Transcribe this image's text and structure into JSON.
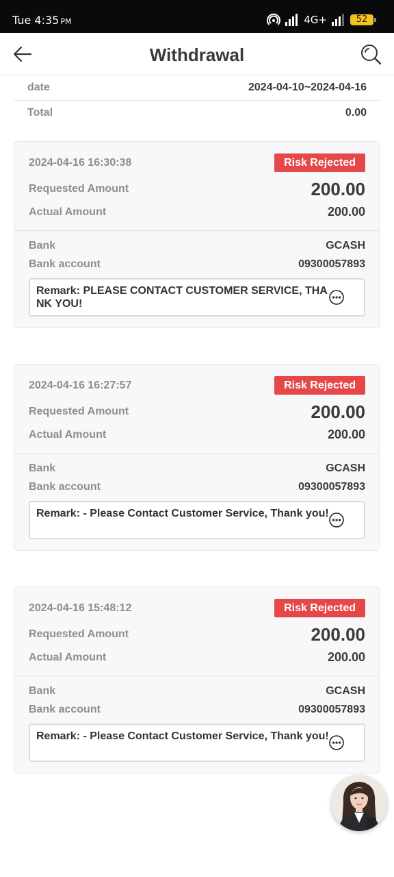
{
  "status_bar": {
    "time": "Tue 4:35",
    "ampm": "PM",
    "network": "4G+",
    "battery": "52"
  },
  "header": {
    "title": "Withdrawal"
  },
  "summary": {
    "date_label": "date",
    "date_value": "2024-04-10~2024-04-16",
    "total_label": "Total",
    "total_value": "0.00"
  },
  "records": [
    {
      "datetime": "2024-04-16 16:30:38",
      "status": "Risk Rejected",
      "requested_label": "Requested Amount",
      "requested_amount": "200.00",
      "actual_label": "Actual Amount",
      "actual_amount": "200.00",
      "bank_label": "Bank",
      "bank": "GCASH",
      "account_label": "Bank account",
      "account": "09300057893",
      "remark": "Remark: PLEASE CONTACT CUSTOMER SERVICE, THANK YOU!"
    },
    {
      "datetime": "2024-04-16 16:27:57",
      "status": "Risk Rejected",
      "requested_label": "Requested Amount",
      "requested_amount": "200.00",
      "actual_label": "Actual Amount",
      "actual_amount": "200.00",
      "bank_label": "Bank",
      "bank": "GCASH",
      "account_label": "Bank account",
      "account": "09300057893",
      "remark": "Remark: - Please Contact Customer Service, Thank you!"
    },
    {
      "datetime": "2024-04-16 15:48:12",
      "status": "Risk Rejected",
      "requested_label": "Requested Amount",
      "requested_amount": "200.00",
      "actual_label": "Actual Amount",
      "actual_amount": "200.00",
      "bank_label": "Bank",
      "bank": "GCASH",
      "account_label": "Bank account",
      "account": "09300057893",
      "remark": "Remark: - Please Contact Customer Service, Thank you!"
    }
  ],
  "colors": {
    "status_bar_bg": "#0a0a0a",
    "badge_red": "#e54848",
    "battery_yellow": "#f4c21b",
    "label_gray": "#8d8d8d",
    "value_dark": "#3a3a3a"
  },
  "icons": {
    "back": "back-arrow-icon",
    "search": "search-icon",
    "more": "more-options-icon",
    "avatar": "customer-service-avatar"
  }
}
